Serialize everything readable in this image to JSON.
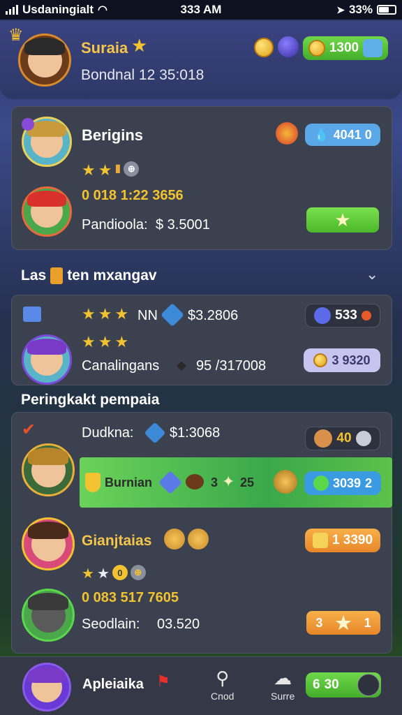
{
  "status_bar": {
    "carrier": "Usdaningialt",
    "time": "333 AM",
    "battery": "33%"
  },
  "header": {
    "player_name": "Suraia",
    "subtitle": "Bondnal 12 35:018",
    "coin_balance": "1300"
  },
  "top_card": {
    "title": "Berigins",
    "balance": "4041 0",
    "coins_line": "0 018 1:22 3656",
    "reward_label": "Pandioola:",
    "reward_value": "$ 3.5001",
    "star_rating": 2
  },
  "section_league": {
    "label": "Las",
    "label_rest": "ten mxangav"
  },
  "mid_card": {
    "row1_rating": 3,
    "row1_badge": "NN",
    "row1_value": "$3.2806",
    "row1_pill": "533",
    "row2_rating": 3,
    "row2_label": "Canalingans",
    "row2_value": "95 /317008",
    "row2_pill": "3 9320"
  },
  "section_ranking": {
    "label": "Peringkakt pempaia"
  },
  "rank_card": {
    "row1_name": "Dudkna:",
    "row1_value": "$1:3068",
    "row1_pill": "40",
    "banner_label": "Burnian",
    "banner_value": "3",
    "banner_value2": "25",
    "banner_pill": "3039",
    "banner_pill_suffix": "2",
    "row2_name": "Gianjtaias",
    "row2_pill": "1 3390",
    "row2_rating": 1,
    "row2_coins": "0 083 517 7605",
    "row2_label": "Seodlain:",
    "row2_value": "03.520",
    "row2_btn_left": "3",
    "row2_btn_right": "1"
  },
  "bottom_nav": {
    "profile_name": "Apleiaika",
    "tab1_label": "Cnod",
    "tab2_label": "Surre",
    "pill_left": "6",
    "pill_value": "30"
  },
  "colors": {
    "accent_gold": "#f2c230",
    "green": "#4cb82a",
    "blue": "#3c9be0",
    "orange": "#f29a2a"
  }
}
